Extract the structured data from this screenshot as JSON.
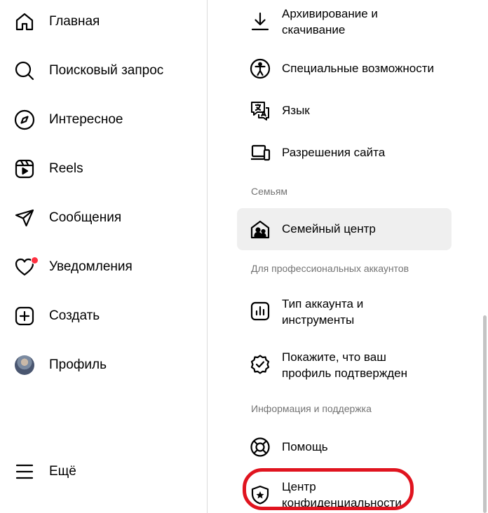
{
  "nav": {
    "items": [
      {
        "label": "Главная",
        "icon": "home-icon"
      },
      {
        "label": "Поисковый запрос",
        "icon": "search-icon"
      },
      {
        "label": "Интересное",
        "icon": "compass-icon"
      },
      {
        "label": "Reels",
        "icon": "reels-icon"
      },
      {
        "label": "Сообщения",
        "icon": "send-icon"
      },
      {
        "label": "Уведомления",
        "icon": "heart-icon"
      },
      {
        "label": "Создать",
        "icon": "plus-square-icon"
      },
      {
        "label": "Профиль",
        "icon": "avatar"
      }
    ],
    "more": {
      "label": "Ещё",
      "icon": "menu-icon"
    },
    "notification_dot_color": "#ff3040"
  },
  "settings_menu": {
    "items_top": [
      {
        "label": "Архивирование и\nскачивание",
        "icon": "download-icon"
      },
      {
        "label": "Специальные возможности",
        "icon": "accessibility-icon"
      },
      {
        "label": "Язык",
        "icon": "language-icon"
      },
      {
        "label": "Разрешения сайта",
        "icon": "devices-icon"
      }
    ],
    "section_family": "Семьям",
    "family_center": {
      "label": "Семейный центр",
      "icon": "family-icon"
    },
    "section_pro": "Для профессиональных аккаунтов",
    "pro_items": [
      {
        "label": "Тип аккаунта и\nинструменты",
        "icon": "chart-icon"
      },
      {
        "label": "Покажите, что ваш\nпрофиль подтвержден",
        "icon": "verified-icon"
      }
    ],
    "section_info": "Информация и поддержка",
    "info_items": [
      {
        "label": "Помощь",
        "icon": "lifebuoy-icon"
      },
      {
        "label": "Центр\nконфиденциальности",
        "icon": "shield-star-icon"
      }
    ]
  },
  "annotation_color": "#e0141f"
}
